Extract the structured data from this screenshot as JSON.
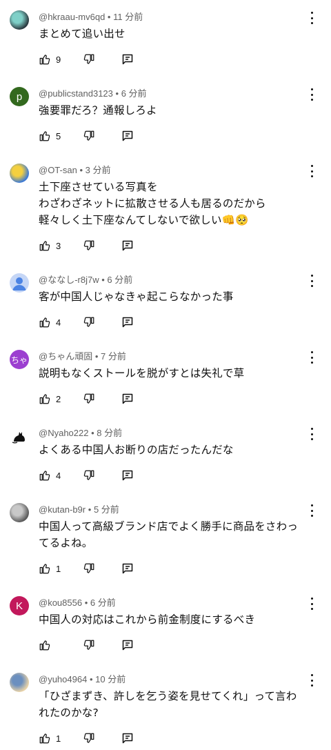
{
  "comments": [
    {
      "author": "@hkraau-mv6qd",
      "sep": "•",
      "time": "11 分前",
      "lines": [
        "まとめて追い出せ"
      ],
      "likes": "9",
      "avatar": {
        "type": "image",
        "colors": [
          "#2b3a40",
          "#7fd0c8"
        ]
      }
    },
    {
      "author": "@publicstand3123",
      "sep": "•",
      "time": "6 分前",
      "lines": [
        "強要罪だろ？通報しろよ"
      ],
      "likes": "5",
      "avatar": {
        "type": "letter",
        "letter": "p",
        "color": "#33691e"
      }
    },
    {
      "author": "@OT-san",
      "sep": "•",
      "time": "3 分前",
      "lines": [
        "土下座させている写真を",
        "わざわざネットに拡散させる人も居るのだから",
        "軽々しく土下座なんてしないで欲しい👊🥺"
      ],
      "likes": "3",
      "avatar": {
        "type": "image",
        "colors": [
          "#3e7bd6",
          "#f4d03f"
        ]
      }
    },
    {
      "author": "@ななし-r8j7w",
      "sep": "•",
      "time": "6 分前",
      "lines": [
        "客が中国人じゃなきゃ起こらなかった事"
      ],
      "likes": "4",
      "avatar": {
        "type": "person",
        "color": "#c5d6f6",
        "fg": "#4a83e4"
      }
    },
    {
      "author": "@ちゃん頑固",
      "sep": "•",
      "time": "7 分前",
      "lines": [
        "説明もなくストールを脱がすとは失礼で草"
      ],
      "likes": "2",
      "avatar": {
        "type": "letter",
        "letter": "ちゃ",
        "color": "#9c3fd0"
      }
    },
    {
      "author": "@Nyaho222",
      "sep": "•",
      "time": "8 分前",
      "lines": [
        "よくある中国人お断りの店だったんだな"
      ],
      "likes": "4",
      "avatar": {
        "type": "cat",
        "colors": [
          "#ffffff",
          "#111111"
        ]
      }
    },
    {
      "author": "@kutan-b9r",
      "sep": "•",
      "time": "5 分前",
      "lines": [
        "中国人って高級ブランド店でよく勝手に商品をさわっ",
        "てるよね。"
      ],
      "likes": "1",
      "avatar": {
        "type": "image",
        "colors": [
          "#5a5a5a",
          "#c8c8c8"
        ]
      }
    },
    {
      "author": "@kou8556",
      "sep": "•",
      "time": "6 分前",
      "lines": [
        "中国人の対応はこれから前金制度にするべき"
      ],
      "likes": "",
      "avatar": {
        "type": "letter",
        "letter": "K",
        "color": "#c2185b"
      }
    },
    {
      "author": "@yuho4964",
      "sep": "•",
      "time": "10 分前",
      "lines": [
        "「ひざまずき、許しを乞う姿を見せてくれ」って言わ",
        "れたのかな?"
      ],
      "likes": "1",
      "avatar": {
        "type": "image",
        "colors": [
          "#e8d2a8",
          "#6b8fbf"
        ]
      }
    }
  ],
  "icons": {
    "like": "thumb-up-icon",
    "dislike": "thumb-down-icon",
    "reply": "reply-comment-icon",
    "menu": "more-vert-icon"
  }
}
